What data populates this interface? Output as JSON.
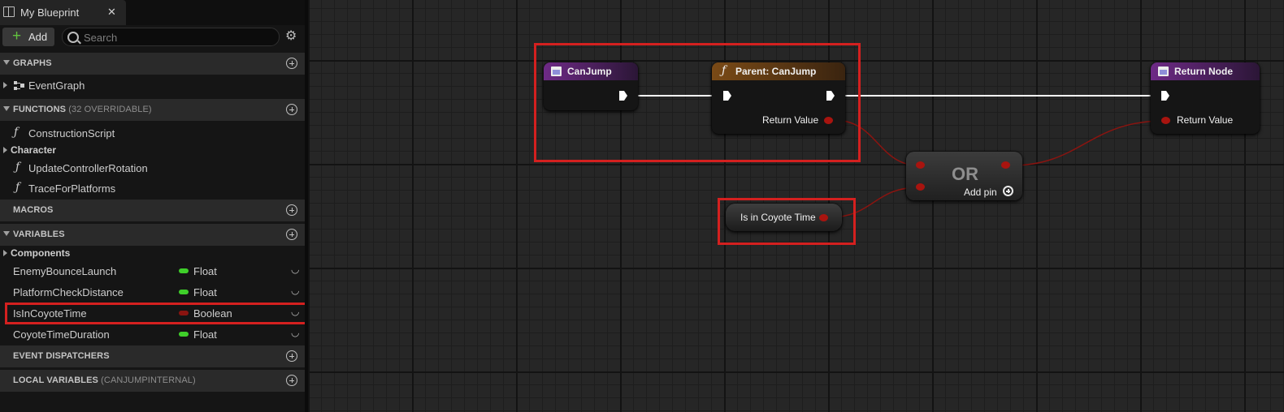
{
  "tab": {
    "title": "My Blueprint",
    "close": "✕"
  },
  "toolbar": {
    "add_label": "Add",
    "search_placeholder": "Search"
  },
  "sections": {
    "graphs": "GRAPHS",
    "functions": "FUNCTIONS",
    "functions_sub": "(32 OVERRIDABLE)",
    "macros": "MACROS",
    "variables": "VARIABLES",
    "event_dispatchers": "EVENT DISPATCHERS",
    "local_variables": "LOCAL VARIABLES",
    "local_variables_sub": "(CANJUMPINTERNAL)"
  },
  "graphs": {
    "items": [
      "EventGraph"
    ]
  },
  "functions": {
    "items": [
      "ConstructionScript",
      "UpdateControllerRotation",
      "TraceForPlatforms"
    ],
    "category": "Character"
  },
  "variables": {
    "category": "Components",
    "items": [
      {
        "name": "EnemyBounceLaunch",
        "type": "Float",
        "color": "#3fcf2a"
      },
      {
        "name": "PlatformCheckDistance",
        "type": "Float",
        "color": "#3fcf2a"
      },
      {
        "name": "IsInCoyoteTime",
        "type": "Boolean",
        "color": "#8a1410"
      },
      {
        "name": "CoyoteTimeDuration",
        "type": "Float",
        "color": "#3fcf2a"
      }
    ]
  },
  "nodes": {
    "canjump": {
      "title": "CanJump",
      "header_color": "#6e2a86"
    },
    "parent_canjump": {
      "title": "Parent: CanJump",
      "return_label": "Return Value",
      "header_color": "#7a4a16"
    },
    "return_node": {
      "title": "Return Node",
      "return_label": "Return Value",
      "header_color": "#6e2a86"
    },
    "or_node": {
      "title": "OR",
      "add_pin": "Add pin"
    },
    "coyote_getter": {
      "label": "Is in Coyote Time"
    }
  },
  "colors": {
    "highlight": "#d4201f",
    "bool_pin": "#a8140f",
    "exec_wire": "#ffffff"
  }
}
